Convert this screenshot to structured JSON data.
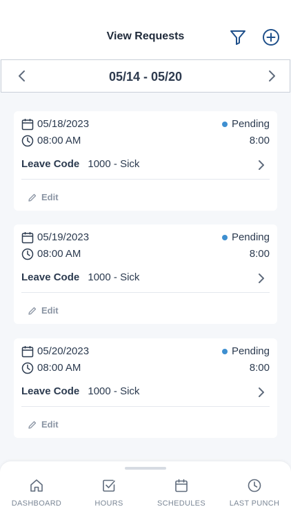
{
  "header": {
    "title": "View Requests",
    "filter_icon": "filter-icon",
    "add_icon": "plus-circle-icon"
  },
  "week_nav": {
    "label": "05/14 - 05/20",
    "prev_icon": "chevron-left-icon",
    "next_icon": "chevron-right-icon"
  },
  "requests": [
    {
      "date": "05/18/2023",
      "time": "08:00 AM",
      "status": "Pending",
      "hours": "8:00",
      "leave_label": "Leave Code",
      "leave_value": "1000 - Sick",
      "edit_label": "Edit"
    },
    {
      "date": "05/19/2023",
      "time": "08:00 AM",
      "status": "Pending",
      "hours": "8:00",
      "leave_label": "Leave Code",
      "leave_value": "1000 - Sick",
      "edit_label": "Edit"
    },
    {
      "date": "05/20/2023",
      "time": "08:00 AM",
      "status": "Pending",
      "hours": "8:00",
      "leave_label": "Leave Code",
      "leave_value": "1000 - Sick",
      "edit_label": "Edit"
    }
  ],
  "tabbar": {
    "tabs": [
      {
        "label": "DASHBOARD",
        "icon": "home-icon"
      },
      {
        "label": "HOURS",
        "icon": "checkbox-icon"
      },
      {
        "label": "SCHEDULES",
        "icon": "calendar-icon"
      },
      {
        "label": "LAST PUNCH",
        "icon": "clock-icon"
      }
    ]
  },
  "colors": {
    "accent": "#1e4f8a",
    "pending_dot": "#3e8fd0",
    "background": "#f5f7fa"
  }
}
